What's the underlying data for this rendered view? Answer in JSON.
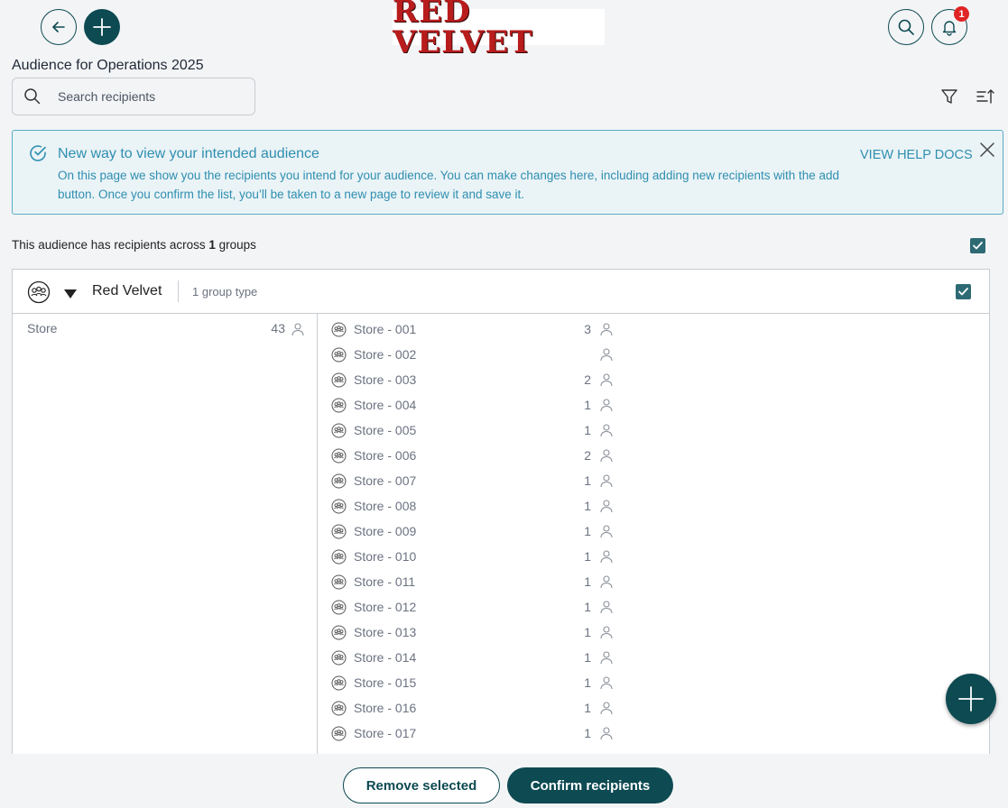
{
  "header": {
    "logo_text": "RED VELVET",
    "notification_count": "1",
    "icons": {
      "back": "arrow-left-icon",
      "add": "plus-icon",
      "search": "search-icon",
      "notifications": "bell-icon"
    }
  },
  "page": {
    "title": "Audience for Operations 2025"
  },
  "search": {
    "placeholder": "Search recipients",
    "value": ""
  },
  "banner": {
    "title": "New way to view your intended audience",
    "body": "On this page we show you the recipients you intend for your audience. You can make changes here, including adding new recipients with the add button. Once you confirm the list, you’ll be taken to a new page to review it and save it.",
    "link": "VIEW HELP DOCS"
  },
  "summary": {
    "prefix": "This audience has recipients across",
    "count": "1",
    "suffix": "groups"
  },
  "group": {
    "name": "Red Velvet",
    "type_label": "1 group type",
    "left_items": [
      {
        "label": "Store",
        "count": "43"
      }
    ],
    "stores": [
      {
        "name": "Store - 001",
        "count": "3"
      },
      {
        "name": "Store - 002",
        "count": ""
      },
      {
        "name": "Store - 003",
        "count": "2"
      },
      {
        "name": "Store - 004",
        "count": "1"
      },
      {
        "name": "Store - 005",
        "count": "1"
      },
      {
        "name": "Store - 006",
        "count": "2"
      },
      {
        "name": "Store - 007",
        "count": "1"
      },
      {
        "name": "Store - 008",
        "count": "1"
      },
      {
        "name": "Store - 009",
        "count": "1"
      },
      {
        "name": "Store - 010",
        "count": "1"
      },
      {
        "name": "Store - 011",
        "count": "1"
      },
      {
        "name": "Store - 012",
        "count": "1"
      },
      {
        "name": "Store - 013",
        "count": "1"
      },
      {
        "name": "Store - 014",
        "count": "1"
      },
      {
        "name": "Store - 015",
        "count": "1"
      },
      {
        "name": "Store - 016",
        "count": "1"
      },
      {
        "name": "Store - 017",
        "count": "1"
      }
    ]
  },
  "footer": {
    "remove_label": "Remove selected",
    "confirm_label": "Confirm recipients"
  },
  "colors": {
    "primary": "#0d4a52",
    "accent": "#2f8fb0",
    "badge": "#e02424",
    "logo": "#b91c1c"
  }
}
